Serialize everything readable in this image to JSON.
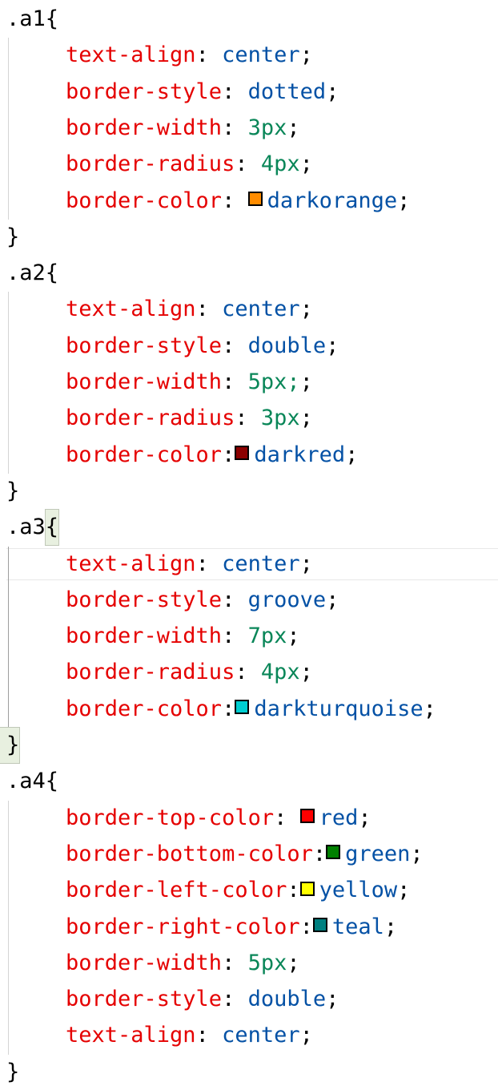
{
  "rules": [
    {
      "selector": ".a1",
      "declarations": [
        {
          "property": "text-align",
          "value": "center",
          "type": "keyword",
          "sep": ": "
        },
        {
          "property": "border-style",
          "value": "dotted",
          "type": "keyword",
          "sep": ": "
        },
        {
          "property": "border-width",
          "value": "3px",
          "type": "number",
          "sep": ": "
        },
        {
          "property": "border-radius",
          "value": "4px",
          "type": "number",
          "sep": ": "
        },
        {
          "property": "border-color",
          "value": "darkorange",
          "type": "color",
          "swatch": "#ff8c00",
          "sep": ": "
        }
      ]
    },
    {
      "selector": ".a2",
      "declarations": [
        {
          "property": "text-align",
          "value": "center",
          "type": "keyword",
          "sep": ": "
        },
        {
          "property": "border-style",
          "value": "double",
          "type": "keyword",
          "sep": ": "
        },
        {
          "property": "border-width",
          "value": "5px;",
          "type": "number",
          "sep": ": "
        },
        {
          "property": "border-radius",
          "value": "3px",
          "type": "number",
          "sep": ": "
        },
        {
          "property": "border-color",
          "value": "darkred",
          "type": "color",
          "swatch": "#8b0000",
          "sep": ":"
        }
      ]
    },
    {
      "selector": ".a3",
      "declarations": [
        {
          "property": "text-align",
          "value": "center",
          "type": "keyword",
          "sep": ": "
        },
        {
          "property": "border-style",
          "value": "groove",
          "type": "keyword",
          "sep": ": "
        },
        {
          "property": "border-width",
          "value": "7px",
          "type": "number",
          "sep": ": "
        },
        {
          "property": "border-radius",
          "value": "4px",
          "type": "number",
          "sep": ": "
        },
        {
          "property": "border-color",
          "value": "darkturquoise",
          "type": "color",
          "swatch": "#00ced1",
          "sep": ":"
        }
      ]
    },
    {
      "selector": ".a4",
      "declarations": [
        {
          "property": "border-top-color",
          "value": "red",
          "type": "color",
          "swatch": "#ff0000",
          "sep": ": "
        },
        {
          "property": "border-bottom-color",
          "value": "green",
          "type": "color",
          "swatch": "#008000",
          "sep": ":"
        },
        {
          "property": "border-left-color",
          "value": "yellow",
          "type": "color",
          "swatch": "#ffff00",
          "sep": ":"
        },
        {
          "property": "border-right-color",
          "value": "teal",
          "type": "color",
          "swatch": "#008080",
          "sep": ":"
        },
        {
          "property": "border-width",
          "value": "5px",
          "type": "number",
          "sep": ": "
        },
        {
          "property": "border-style",
          "value": "double",
          "type": "keyword",
          "sep": ": "
        },
        {
          "property": "text-align",
          "value": "center",
          "type": "keyword",
          "sep": ": "
        }
      ]
    }
  ],
  "syntax_colors": {
    "property": "#e50000",
    "keyword": "#0451a5",
    "number": "#098658",
    "punctuation": "#000000"
  }
}
